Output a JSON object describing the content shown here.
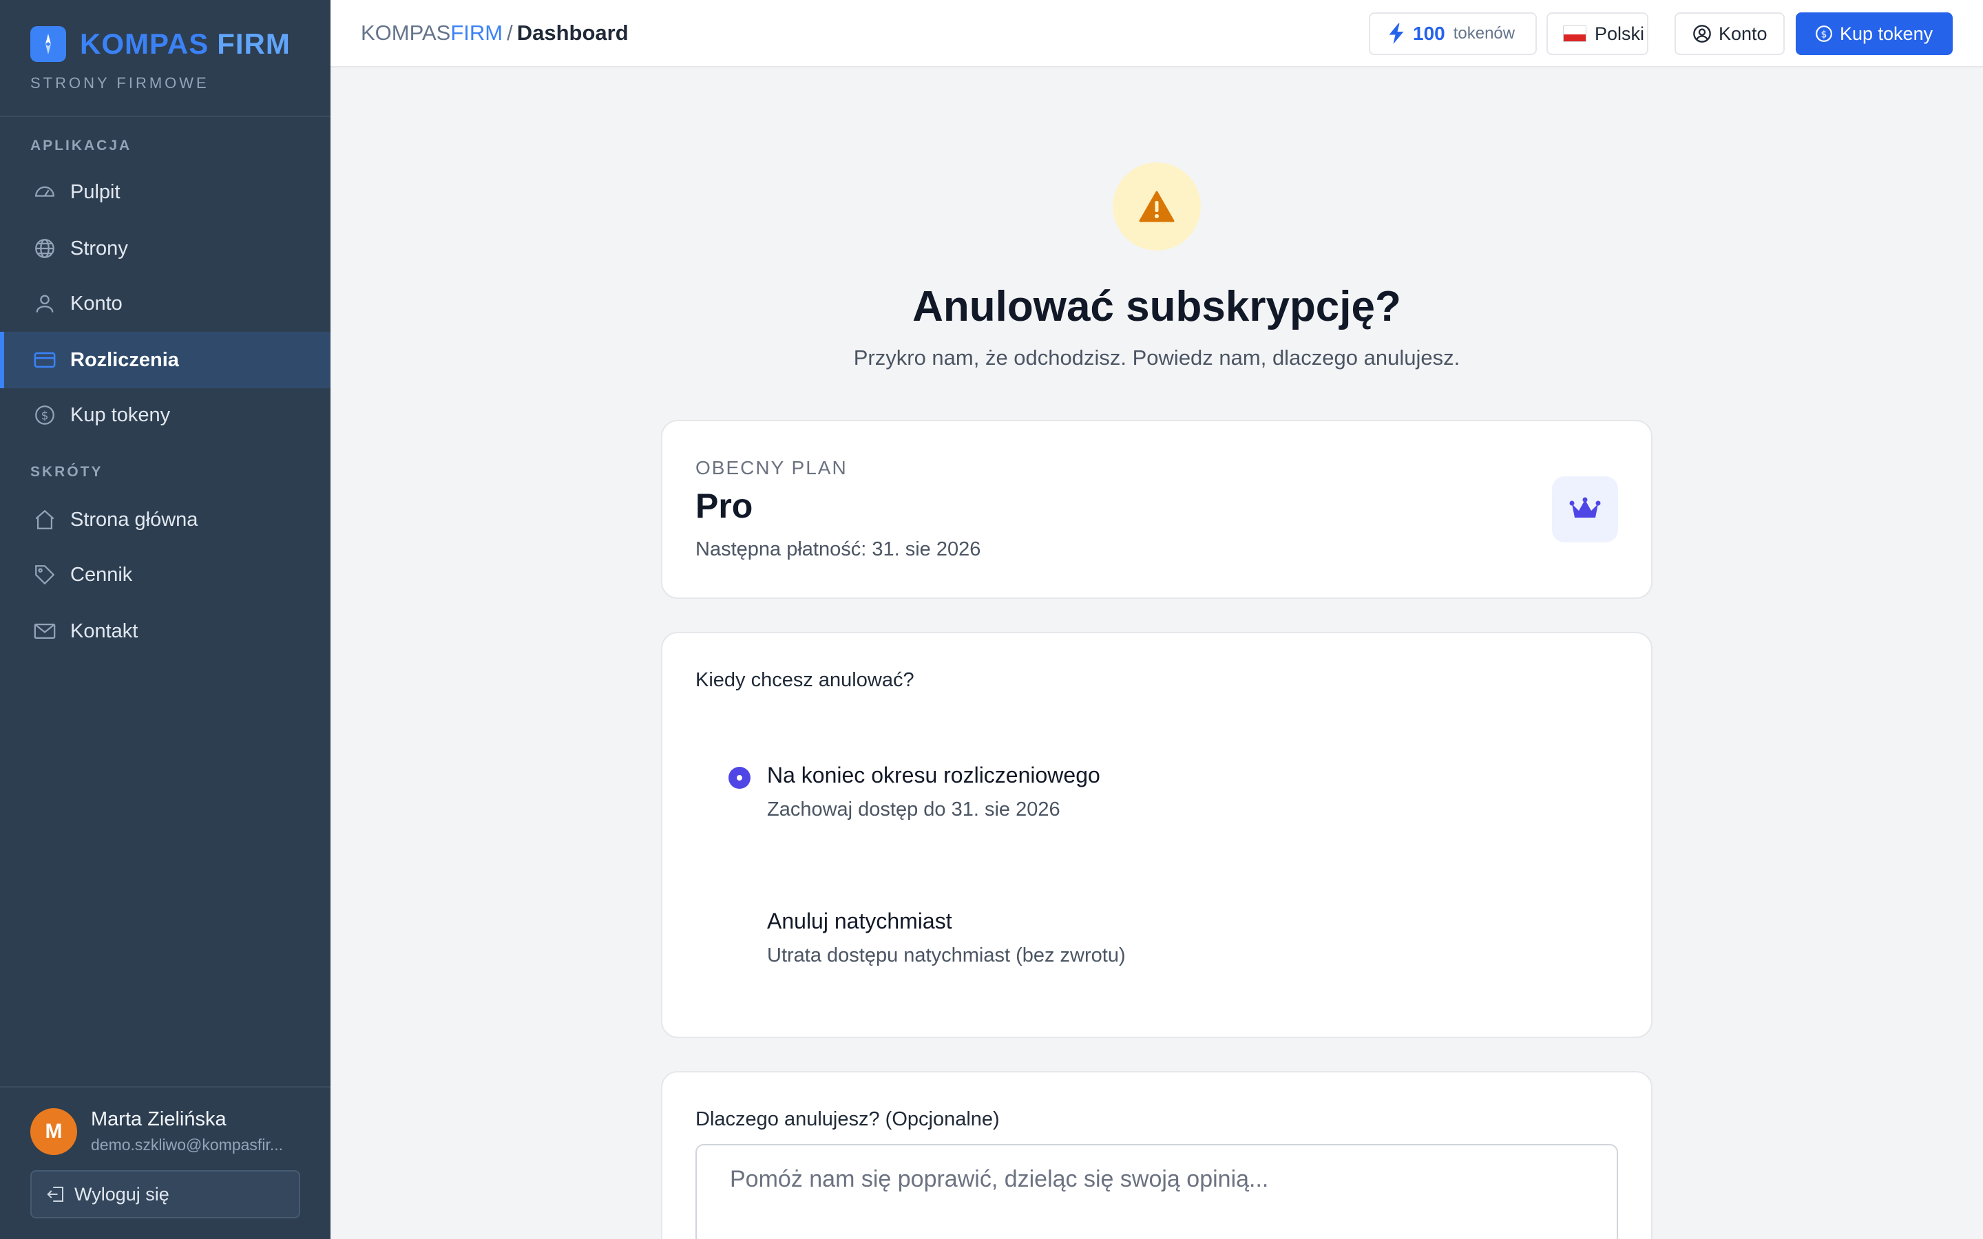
{
  "brand": {
    "name_part1": "KOMPAS",
    "name_part2": "FIRM",
    "subtitle": "STRONY FIRMOWE"
  },
  "sidebar": {
    "section_app": "APLIKACJA",
    "app_items": [
      {
        "label": "Pulpit",
        "icon": "dashboard-gauge-icon"
      },
      {
        "label": "Strony",
        "icon": "globe-icon"
      },
      {
        "label": "Konto",
        "icon": "user-icon"
      },
      {
        "label": "Rozliczenia",
        "icon": "credit-card-icon",
        "active": true
      },
      {
        "label": "Kup tokeny",
        "icon": "coin-icon"
      }
    ],
    "section_shortcuts": "SKRÓTY",
    "shortcut_items": [
      {
        "label": "Strona główna",
        "icon": "home-icon"
      },
      {
        "label": "Cennik",
        "icon": "tag-icon"
      },
      {
        "label": "Kontakt",
        "icon": "envelope-icon"
      }
    ],
    "user": {
      "initial": "M",
      "name": "Marta Zielińska",
      "email": "demo.szkliwo@kompasfir..."
    },
    "logout_label": "Wyloguj się"
  },
  "header": {
    "breadcrumb_part1": "KOMPAS",
    "breadcrumb_part2": "FIRM",
    "breadcrumb_sep": "/",
    "breadcrumb_current": "Dashboard",
    "tokens_count": "100",
    "tokens_label": "tokenów",
    "language": "Polski",
    "account_label": "Konto",
    "buy_label": "Kup tokeny"
  },
  "main": {
    "title": "Anulować subskrypcję?",
    "subtitle": "Przykro nam, że odchodzisz. Powiedz nam, dlaczego anulujesz.",
    "plan": {
      "label": "OBECNY PLAN",
      "name": "Pro",
      "next_payment": "Następna płatność: 31. sie 2026"
    },
    "when": {
      "question": "Kiedy chcesz anulować?",
      "options": [
        {
          "title": "Na koniec okresu rozliczeniowego",
          "desc": "Zachowaj dostęp do 31. sie 2026",
          "selected": true
        },
        {
          "title": "Anuluj natychmiast",
          "desc": "Utrata dostępu natychmiast (bez zwrotu)",
          "selected": false
        }
      ]
    },
    "why": {
      "question": "Dlaczego anulujesz? (Opcjonalne)",
      "placeholder": "Pomóż nam się poprawić, dzieląc się swoją opinią...",
      "value": ""
    }
  },
  "colors": {
    "sidebar_bg": "#2d3e50",
    "accent": "#2563eb",
    "selected_radio": "#4f46e5",
    "warning": "#d97706",
    "warning_bg": "#fef3c7",
    "avatar": "#ea7a1f"
  }
}
